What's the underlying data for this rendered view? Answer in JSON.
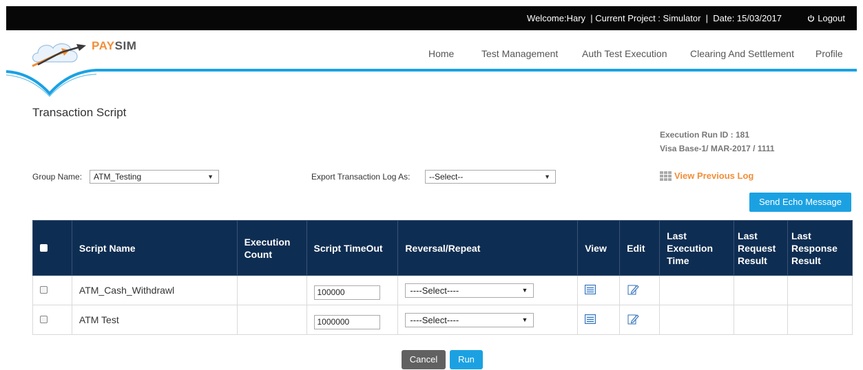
{
  "topbar": {
    "info": "Welcome:Hary  | Current Project : Simulator  |  Date: 15/03/2017",
    "logout": "Logout"
  },
  "logo": {
    "pay": "PAY",
    "sim": "SIM"
  },
  "nav": [
    "Home",
    "Test Management",
    "Auth Test Execution",
    "Clearing And Settlement",
    "Profile"
  ],
  "page": {
    "title": "Transaction Script",
    "run_id": "Execution Run ID : 181",
    "run_detail": "Visa Base-1/ MAR-2017 / 1111"
  },
  "filters": {
    "group_label": "Group Name:",
    "group_value": "ATM_Testing",
    "export_label": "Export Transaction Log As:",
    "export_value": "--Select--",
    "view_previous_log": "View Previous Log",
    "send_echo": "Send Echo Message"
  },
  "table": {
    "headers": {
      "name": "Script Name",
      "count": "Execution Count",
      "timeout": "Script TimeOut",
      "reversal": "Reversal/Repeat",
      "view": "View",
      "edit": "Edit",
      "last_exec": "Last Execution Time",
      "last_req": "Last Request Result",
      "last_resp": "Last Response Result"
    },
    "rows": [
      {
        "name": "ATM_Cash_Withdrawl",
        "count": "",
        "timeout": "100000",
        "reversal": "----Select----",
        "last_exec": "",
        "last_req": "",
        "last_resp": ""
      },
      {
        "name": "ATM Test",
        "count": "",
        "timeout": "1000000",
        "reversal": "----Select----",
        "last_exec": "",
        "last_req": "",
        "last_resp": ""
      }
    ]
  },
  "actions": {
    "cancel": "Cancel",
    "run": "Run"
  },
  "colors": {
    "accent": "#1ba1e2",
    "header": "#0e2d52",
    "brand_orange": "#f08e3a"
  }
}
